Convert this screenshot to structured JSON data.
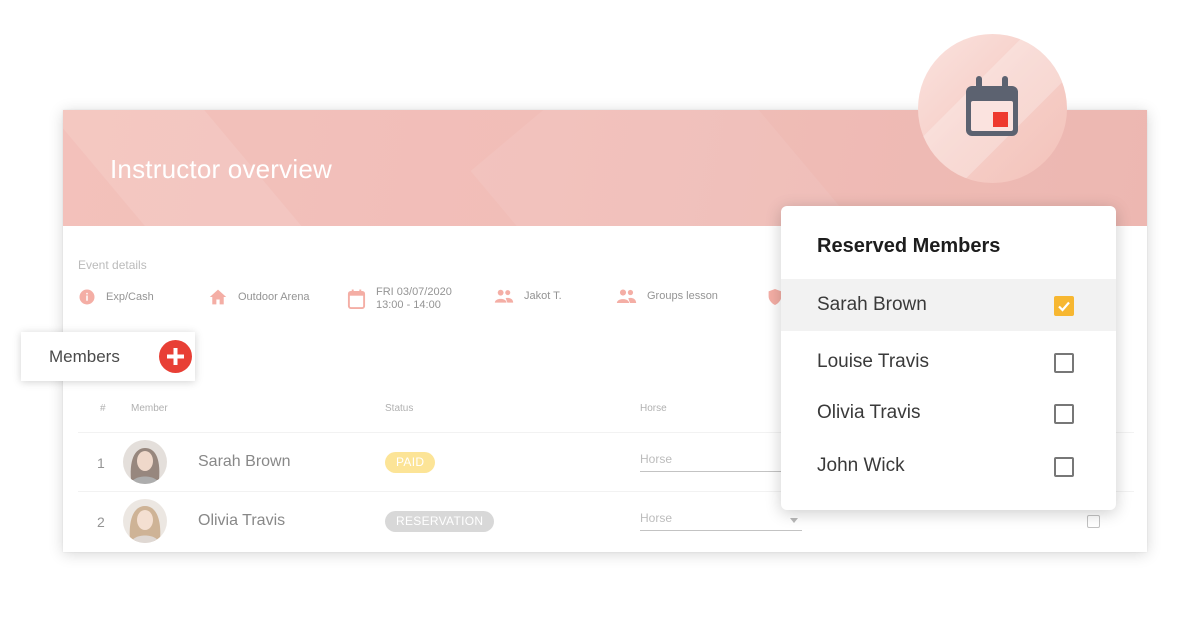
{
  "header": {
    "title": "Instructor overview"
  },
  "event_details": {
    "section_label": "Event details",
    "payment": "Exp/Cash",
    "location": "Outdoor Arena",
    "date": "FRI 03/07/2020",
    "time": "13:00 - 14:00",
    "instructor": "Jakot T.",
    "lesson_type": "Groups lesson"
  },
  "members": {
    "label": "Members"
  },
  "table": {
    "headers": {
      "num": "#",
      "member": "Member",
      "status": "Status",
      "horse": "Horse"
    },
    "rows": [
      {
        "num": "1",
        "name": "Sarah Brown",
        "status": "PAID",
        "horse_placeholder": "Horse"
      },
      {
        "num": "2",
        "name": "Olivia Travis",
        "status": "RESERVATION",
        "horse_placeholder": "Horse"
      }
    ]
  },
  "reserved_members": {
    "title": "Reserved Members",
    "items": [
      {
        "name": "Sarah Brown",
        "checked": true
      },
      {
        "name": "Louise Travis",
        "checked": false
      },
      {
        "name": "Olivia Travis",
        "checked": false
      },
      {
        "name": "John Wick",
        "checked": false
      }
    ]
  },
  "colors": {
    "hero": "#eba29a",
    "accent_red": "#e83f35",
    "paid": "#fbd96a",
    "reservation": "#c7c7c7",
    "checkbox_checked": "#f7b731",
    "icon_salmon": "#f08b7f"
  },
  "icons": {
    "payment": "info-icon",
    "location": "home-icon",
    "date": "calendar-icon",
    "instructor": "person-icon",
    "lesson_type": "group-icon",
    "badge": "calendar-icon",
    "add": "plus-icon"
  }
}
